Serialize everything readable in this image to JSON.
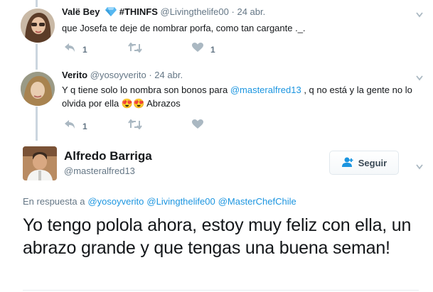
{
  "replies": [
    {
      "name": "Valë Bey",
      "verified_emoji": "diamond-icon",
      "hashtag": "#THINFS",
      "handle": "@Livingthelife00",
      "dot": "·",
      "time": "24 abr.",
      "text": "que Josefa te deje de nombrar porfa, como tan cargante ._.",
      "reply_count": "1",
      "retweet_count": "",
      "like_count": "1"
    },
    {
      "name": "Verito",
      "handle": "@yosoyverito",
      "dot": "·",
      "time": "24 abr.",
      "text_pre": "Y q tiene solo lo nombra son bonos para ",
      "text_mention": "@masteralfred13",
      "text_post": " , q no está y la gente no lo olvida por ella ",
      "text_emoji": "😍😍",
      "text_end": " Abrazos",
      "reply_count": "1",
      "retweet_count": "",
      "like_count": ""
    }
  ],
  "main_tweet": {
    "name": "Alfredo Barriga",
    "handle": "@masteralfred13",
    "follow_label": "Seguir",
    "reply_prefix": "En respuesta a",
    "reply_mentions": [
      "@yosoyverito",
      "@Livingthelife00",
      "@MasterChefChile"
    ],
    "text": "Yo tengo polola ahora, estoy muy feliz con ella, un abrazo grande y que tengas una buena seman!"
  },
  "colors": {
    "link": "#1b95e0",
    "muted": "#657786",
    "icon": "#aab8c2"
  }
}
